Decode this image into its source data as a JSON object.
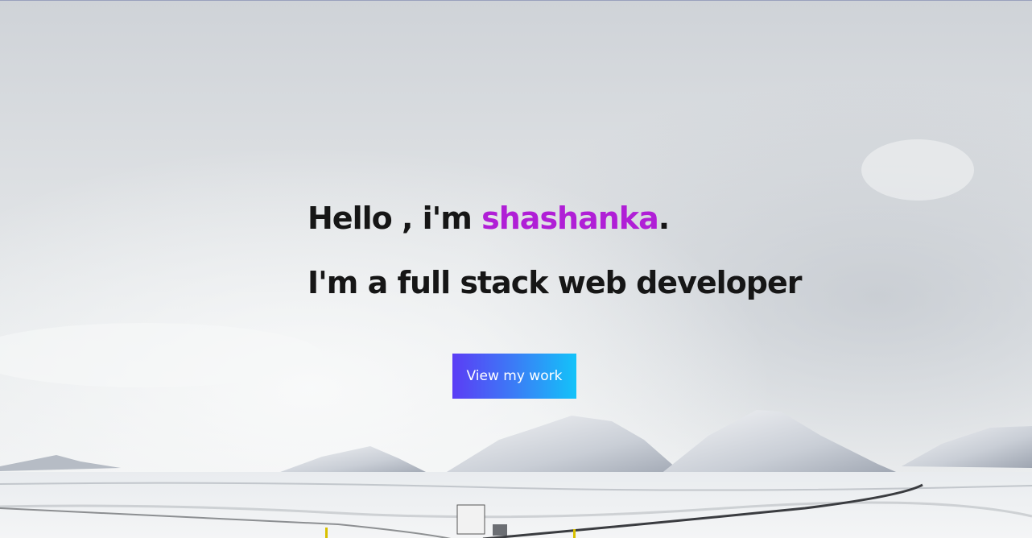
{
  "hero": {
    "greeting_prefix": "Hello , i'm ",
    "name": "shashanka",
    "greeting_suffix": ".",
    "tagline": "I'm a full stack web developer",
    "cta_label": "View my work"
  },
  "colors": {
    "name_accent": "#b01fd6",
    "text": "#161616",
    "cta_gradient_start": "#5b3df5",
    "cta_gradient_end": "#13c3f9"
  },
  "background": {
    "scene": "snowy-mountain-landscape"
  }
}
